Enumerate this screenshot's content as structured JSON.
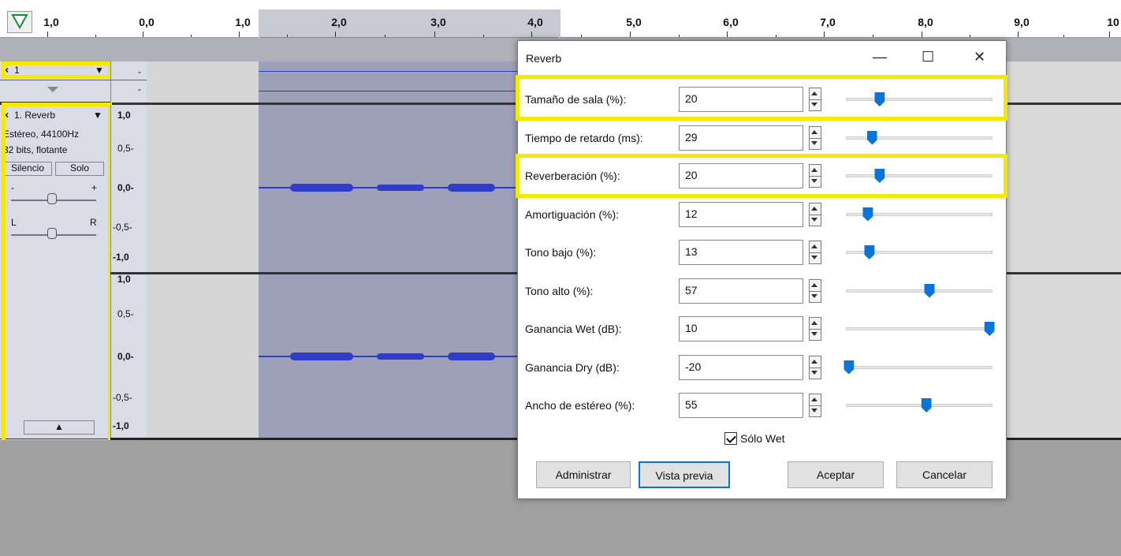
{
  "ruler": {
    "labels": [
      "1,0",
      "0,0",
      "1,0",
      "2,0",
      "3,0",
      "4,0",
      "5,0",
      "6,0",
      "7,0",
      "8,0",
      "9,0",
      "10"
    ]
  },
  "track1": {
    "name": "1",
    "close": "×",
    "dropdown": "▼"
  },
  "track2": {
    "name": "1. Reverb",
    "close": "×",
    "info1": "Estéreo, 44100Hz",
    "info2": "32 bits, flotante",
    "mute_label": "Silencio",
    "solo_label": "Solo",
    "gain_minus": "-",
    "gain_plus": "+",
    "pan_left": "L",
    "pan_right": "R",
    "collapse": "▲"
  },
  "scale_top": [
    "1,0",
    "0,5-",
    "0,0-",
    "-0,5-",
    "-1,0"
  ],
  "scale_bottom": [
    "1,0",
    "0,5-",
    "0,0-",
    "-0,5-",
    "-1,0"
  ],
  "dialog": {
    "title": "Reverb",
    "minimize": "—",
    "maximize": "☐",
    "close": "✕",
    "params": [
      {
        "label": "Tamaño de sala (%):",
        "value": "20",
        "level": 0.23
      },
      {
        "label": "Tiempo de retardo (ms):",
        "value": "29",
        "level": 0.18
      },
      {
        "label": "Reverberación (%):",
        "value": "20",
        "level": 0.23
      },
      {
        "label": "Amortiguación (%):",
        "value": "12",
        "level": 0.15
      },
      {
        "label": "Tono bajo (%):",
        "value": "13",
        "level": 0.16
      },
      {
        "label": "Tono alto (%):",
        "value": "57",
        "level": 0.57
      },
      {
        "label": "Ganancia Wet (dB):",
        "value": "10",
        "level": 0.98
      },
      {
        "label": "Ganancia Dry (dB):",
        "value": "-20",
        "level": 0.02
      },
      {
        "label": "Ancho de estéreo (%):",
        "value": "55",
        "level": 0.55
      }
    ],
    "wet_only": "Sólo Wet",
    "manage": "Administrar",
    "preview": "Vista previa",
    "ok": "Aceptar",
    "cancel": "Cancelar"
  },
  "colors": {
    "accent": "#0a74d8",
    "highlight": "#f5e900",
    "waveform": "#2f3cc7",
    "selection": "#9ea0b9"
  }
}
